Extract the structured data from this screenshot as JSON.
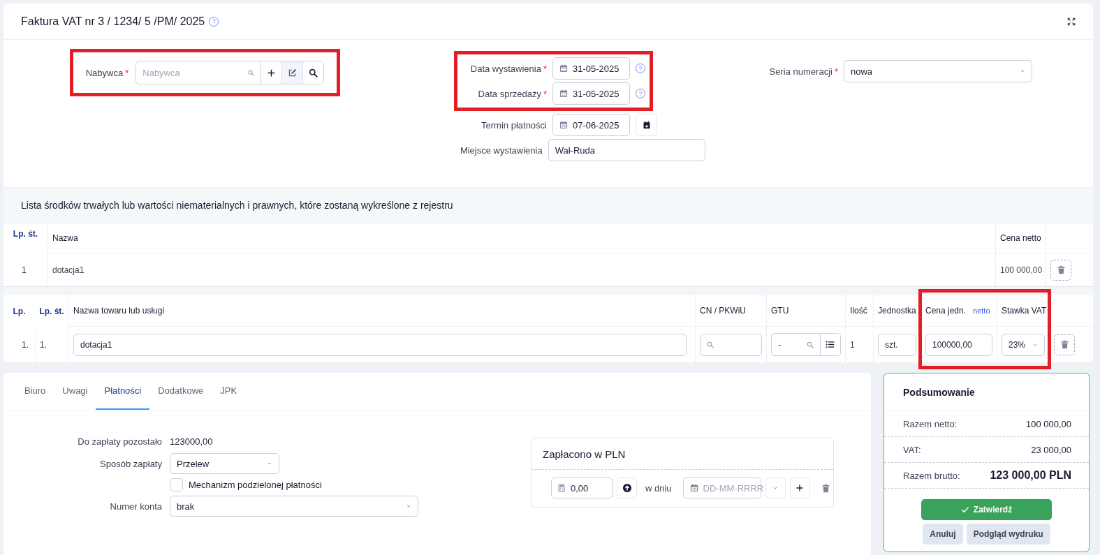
{
  "header": {
    "title": "Faktura VAT nr 3 / 1234/ 5 /PM/ 2025",
    "help_icon": "?"
  },
  "buyer": {
    "label": "Nabywca",
    "required_mark": "*",
    "placeholder": "Nabywca",
    "highlighted": true
  },
  "issue_dates": {
    "highlighted": true,
    "fields": [
      {
        "kind": "date",
        "label": "Data wystawienia",
        "required_mark": "*",
        "value": "31-05-2025",
        "help_icon": "?"
      },
      {
        "kind": "date",
        "label": "Data sprzedaży",
        "required_mark": "*",
        "value": "31-05-2025",
        "help_icon": "?"
      }
    ]
  },
  "more_fields": [
    {
      "kind": "date-add",
      "label": "Termin płatności",
      "value": "07-06-2025"
    },
    {
      "kind": "text",
      "label": "Miejsce wystawienia",
      "value": "Wał-Ruda"
    }
  ],
  "series": {
    "label": "Seria numeracji",
    "required_mark": "*",
    "value": "nowa"
  },
  "assets": {
    "title": "Lista środków trwałych lub wartości niematerialnych i prawnych, które zostaną wykreślone z rejestru",
    "columns": [
      "Lp. śt.",
      "Nazwa",
      "Cena netto"
    ],
    "rows": [
      {
        "lp": "1",
        "name": "dotacja1",
        "price": "100 000,00"
      }
    ]
  },
  "items": {
    "price_columns_highlighted": true,
    "columns": [
      {
        "label": "Lp."
      },
      {
        "label": "Lp. śt."
      },
      {
        "label": "Nazwa towaru lub usługi"
      },
      {
        "label": "CN / PKWiU"
      },
      {
        "label": "GTU"
      },
      {
        "label": "Ilość"
      },
      {
        "label": "Jednostka"
      },
      {
        "label": "Cena jedn.",
        "note": "netto"
      },
      {
        "label": "Stawka VAT"
      }
    ],
    "rows": [
      {
        "lp": "1.",
        "lp_st": "1.",
        "name": "dotacja1",
        "gtu": "-",
        "qty": "1",
        "unit": "szt.",
        "price": "100000,00",
        "vat": "23%"
      }
    ]
  },
  "tabs": [
    {
      "label": "Biuro",
      "selected": false
    },
    {
      "label": "Uwagi",
      "selected": false
    },
    {
      "label": "Płatności",
      "selected": true
    },
    {
      "label": "Dodatkowe",
      "selected": false
    },
    {
      "label": "JPK",
      "selected": false
    }
  ],
  "payment": [
    {
      "kind": "text",
      "label": "Do zapłaty pozostało",
      "value": "123000,00"
    },
    {
      "kind": "select",
      "label": "Sposób zapłaty",
      "value": "Przelew"
    },
    {
      "kind": "checkbox",
      "label": "Mechanizm podzielonej płatności",
      "checked": false
    },
    {
      "kind": "select-wide",
      "label": "Numer konta",
      "value": "brak"
    }
  ],
  "paid": {
    "title": "Zapłacono w PLN",
    "amount": "0,00",
    "date_label": "w dniu",
    "date_placeholder": "DD-MM-RRRR"
  },
  "summary": {
    "title": "Podsumowanie",
    "rows": [
      {
        "label": "Razem netto:",
        "value": "100 000,00",
        "emphasis": false
      },
      {
        "label": "VAT:",
        "value": "23 000,00",
        "emphasis": false
      },
      {
        "label": "Razem brutto:",
        "value": "123 000,00 PLN",
        "emphasis": true
      }
    ],
    "buttons": [
      {
        "kind": "primary",
        "label": "Zatwierdź"
      },
      {
        "kind": "secondary",
        "label": "Anuluj"
      },
      {
        "kind": "secondary",
        "label": "Podgląd wydruku"
      }
    ]
  }
}
